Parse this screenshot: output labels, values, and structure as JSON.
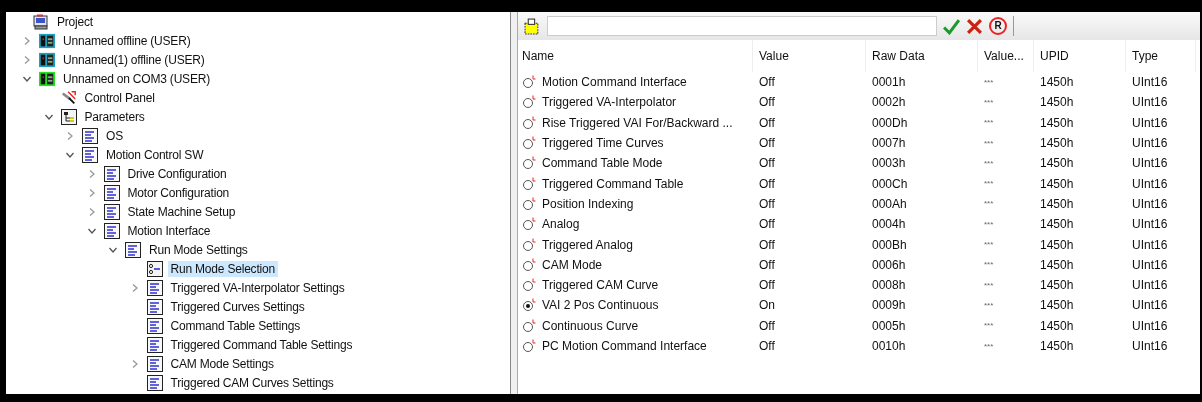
{
  "tree": [
    {
      "label": "Project",
      "kind": "project",
      "selected": false,
      "children": [
        {
          "label": "Unnamed offline (USER)",
          "kind": "device",
          "color": "#1e9fc0",
          "expanded": false,
          "selected": false
        },
        {
          "label": "Unnamed(1) offline (USER)",
          "kind": "device",
          "color": "#1e9fc0",
          "expanded": false,
          "selected": false
        },
        {
          "label": "Unnamed on COM3 (USER)",
          "kind": "device",
          "color": "#22e022",
          "expanded": true,
          "selected": false,
          "children": [
            {
              "label": "Control Panel",
              "kind": "control_panel",
              "selected": false
            },
            {
              "label": "Parameters",
              "kind": "parameters",
              "expanded": true,
              "selected": false,
              "children": [
                {
                  "label": "OS",
                  "kind": "group",
                  "expanded": false,
                  "selected": false
                },
                {
                  "label": "Motion Control SW",
                  "kind": "group",
                  "expanded": true,
                  "selected": false,
                  "children": [
                    {
                      "label": "Drive Configuration",
                      "kind": "group",
                      "expanded": false,
                      "selected": false
                    },
                    {
                      "label": "Motor Configuration",
                      "kind": "group",
                      "expanded": false,
                      "selected": false
                    },
                    {
                      "label": "State Machine Setup",
                      "kind": "group",
                      "expanded": false,
                      "selected": false
                    },
                    {
                      "label": "Motion Interface",
                      "kind": "group",
                      "expanded": true,
                      "selected": false,
                      "children": [
                        {
                          "label": "Run Mode Settings",
                          "kind": "group",
                          "expanded": true,
                          "selected": false,
                          "children": [
                            {
                              "label": "Run Mode Selection",
                              "kind": "selection",
                              "selected": true
                            },
                            {
                              "label": "Triggered VA-Interpolator Settings",
                              "kind": "group",
                              "expanded": false,
                              "selected": false
                            },
                            {
                              "label": "Triggered Curves Settings",
                              "kind": "group",
                              "selected": false
                            },
                            {
                              "label": "Command Table Settings",
                              "kind": "group",
                              "selected": false
                            },
                            {
                              "label": "Triggered Command Table Settings",
                              "kind": "group",
                              "selected": false
                            },
                            {
                              "label": "CAM Mode Settings",
                              "kind": "group",
                              "expanded": false,
                              "selected": false
                            },
                            {
                              "label": "Triggered CAM Curves Settings",
                              "kind": "group",
                              "selected": false
                            }
                          ]
                        }
                      ]
                    }
                  ]
                }
              ]
            }
          ]
        }
      ]
    }
  ],
  "toolbar": {
    "reset_letter": "R"
  },
  "table": {
    "columns": [
      "Name",
      "Value",
      "Raw Data",
      "Value...",
      "UPID",
      "Type"
    ],
    "rows": [
      {
        "checked": false,
        "name": "Motion Command Interface",
        "value": "Off",
        "raw": "0001h",
        "value_desc": "***",
        "upid": "1450h",
        "type": "UInt16"
      },
      {
        "checked": false,
        "name": "Triggered VA-Interpolator",
        "value": "Off",
        "raw": "0002h",
        "value_desc": "***",
        "upid": "1450h",
        "type": "UInt16"
      },
      {
        "checked": false,
        "name": "Rise Triggered VAI For/Backward ...",
        "value": "Off",
        "raw": "000Dh",
        "value_desc": "***",
        "upid": "1450h",
        "type": "UInt16"
      },
      {
        "checked": false,
        "name": "Triggered Time Curves",
        "value": "Off",
        "raw": "0007h",
        "value_desc": "***",
        "upid": "1450h",
        "type": "UInt16"
      },
      {
        "checked": false,
        "name": "Command Table Mode",
        "value": "Off",
        "raw": "0003h",
        "value_desc": "***",
        "upid": "1450h",
        "type": "UInt16"
      },
      {
        "checked": false,
        "name": "Triggered Command Table",
        "value": "Off",
        "raw": "000Ch",
        "value_desc": "***",
        "upid": "1450h",
        "type": "UInt16"
      },
      {
        "checked": false,
        "name": "Position Indexing",
        "value": "Off",
        "raw": "000Ah",
        "value_desc": "***",
        "upid": "1450h",
        "type": "UInt16"
      },
      {
        "checked": false,
        "name": "Analog",
        "value": "Off",
        "raw": "0004h",
        "value_desc": "***",
        "upid": "1450h",
        "type": "UInt16"
      },
      {
        "checked": false,
        "name": "Triggered Analog",
        "value": "Off",
        "raw": "000Bh",
        "value_desc": "***",
        "upid": "1450h",
        "type": "UInt16"
      },
      {
        "checked": false,
        "name": "CAM Mode",
        "value": "Off",
        "raw": "0006h",
        "value_desc": "***",
        "upid": "1450h",
        "type": "UInt16"
      },
      {
        "checked": false,
        "name": "Triggered CAM Curve",
        "value": "Off",
        "raw": "0008h",
        "value_desc": "***",
        "upid": "1450h",
        "type": "UInt16"
      },
      {
        "checked": true,
        "name": "VAI 2 Pos Continuous",
        "value": "On",
        "raw": "0009h",
        "value_desc": "***",
        "upid": "1450h",
        "type": "UInt16"
      },
      {
        "checked": false,
        "name": "Continuous Curve",
        "value": "Off",
        "raw": "0005h",
        "value_desc": "***",
        "upid": "1450h",
        "type": "UInt16"
      },
      {
        "checked": false,
        "name": "PC Motion Command Interface",
        "value": "Off",
        "raw": "0010h",
        "value_desc": "***",
        "upid": "1450h",
        "type": "UInt16"
      }
    ]
  }
}
